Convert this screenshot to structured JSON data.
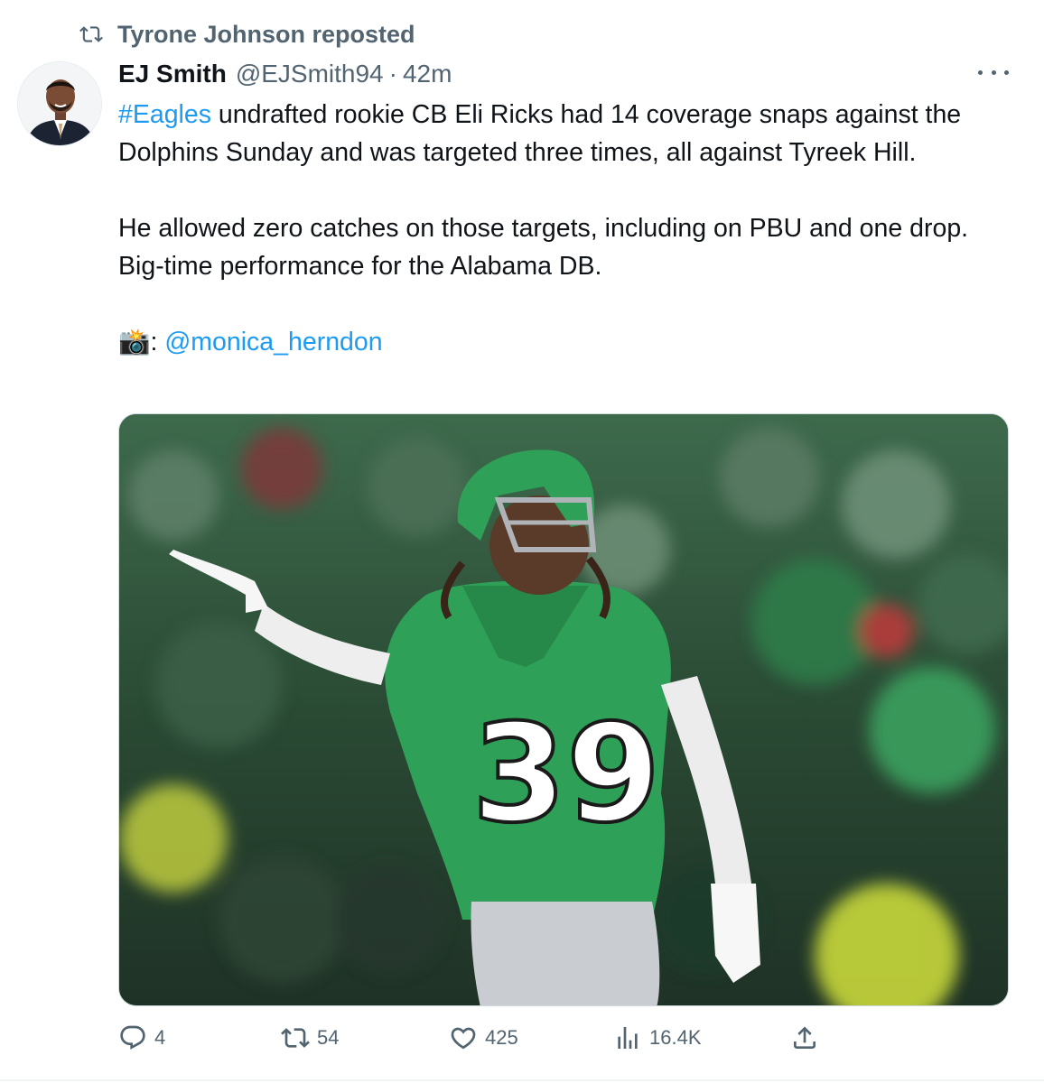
{
  "repost": {
    "label": "Tyrone Johnson reposted",
    "icon": "repost-icon"
  },
  "author": {
    "name": "EJ Smith",
    "handle": "@EJSmith94",
    "separator": "·",
    "time": "42m",
    "avatar_icon": "avatar"
  },
  "tweet": {
    "hashtag": "#Eagles",
    "line1_rest": " undrafted rookie CB Eli Ricks had 14 coverage snaps against the Dolphins Sunday and was targeted three times, all against Tyreek Hill.",
    "para2": "He allowed zero catches on those targets, including on PBU and one drop. Big-time performance for the Alabama DB.",
    "photo_emoji": "📸",
    "credit_sep": ": ",
    "credit_mention": "@monica_herndon"
  },
  "media": {
    "jersey_number": "39",
    "colors": {
      "jersey": "#2fa058",
      "crowd": "#2b4a35",
      "pants": "#c9ccd0"
    }
  },
  "actions": {
    "replies": "4",
    "reposts": "54",
    "likes": "425",
    "views": "16.4K"
  },
  "colors": {
    "accent": "#1d9bf0",
    "secondary_text": "#536471",
    "text": "#0f1419"
  }
}
